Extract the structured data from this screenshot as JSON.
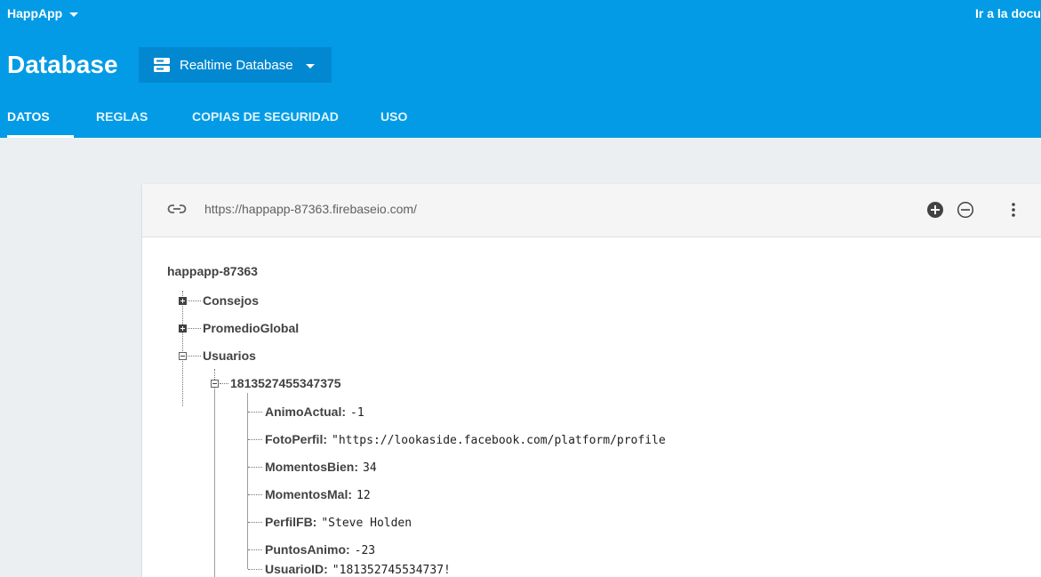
{
  "header": {
    "project_name": "HappApp",
    "docs_link": "Ir a la documentación",
    "page_title": "Database",
    "db_selector_label": "Realtime Database"
  },
  "tabs": [
    {
      "label": "DATOS",
      "active": true
    },
    {
      "label": "REGLAS",
      "active": false
    },
    {
      "label": "COPIAS DE SEGURIDAD",
      "active": false
    },
    {
      "label": "USO",
      "active": false
    }
  ],
  "database": {
    "url": "https://happapp-87363.firebaseio.com/",
    "root": "happapp-87363",
    "nodes": [
      {
        "key": "Consejos",
        "expanded": false
      },
      {
        "key": "PromedioGlobal",
        "expanded": false
      },
      {
        "key": "Usuarios",
        "expanded": true
      }
    ],
    "user": {
      "key": "1813527455347375",
      "expanded": true,
      "fields": [
        {
          "key": "AnimoActual:",
          "value": "-1"
        },
        {
          "key": "FotoPerfil:",
          "value": "\"https://lookaside.facebook.com/platform/profile"
        },
        {
          "key": "MomentosBien:",
          "value": "34"
        },
        {
          "key": "MomentosMal:",
          "value": "12"
        },
        {
          "key": "PerfilFB:",
          "value": "\"Steve Holden"
        },
        {
          "key": "PuntosAnimo:",
          "value": "-23"
        },
        {
          "key": "UsuarioID:",
          "value": "\"181352745534737!"
        }
      ]
    }
  },
  "colors": {
    "header_bg": "#039be5",
    "selector_bg": "#0288d1",
    "page_bg": "#eceff1"
  }
}
